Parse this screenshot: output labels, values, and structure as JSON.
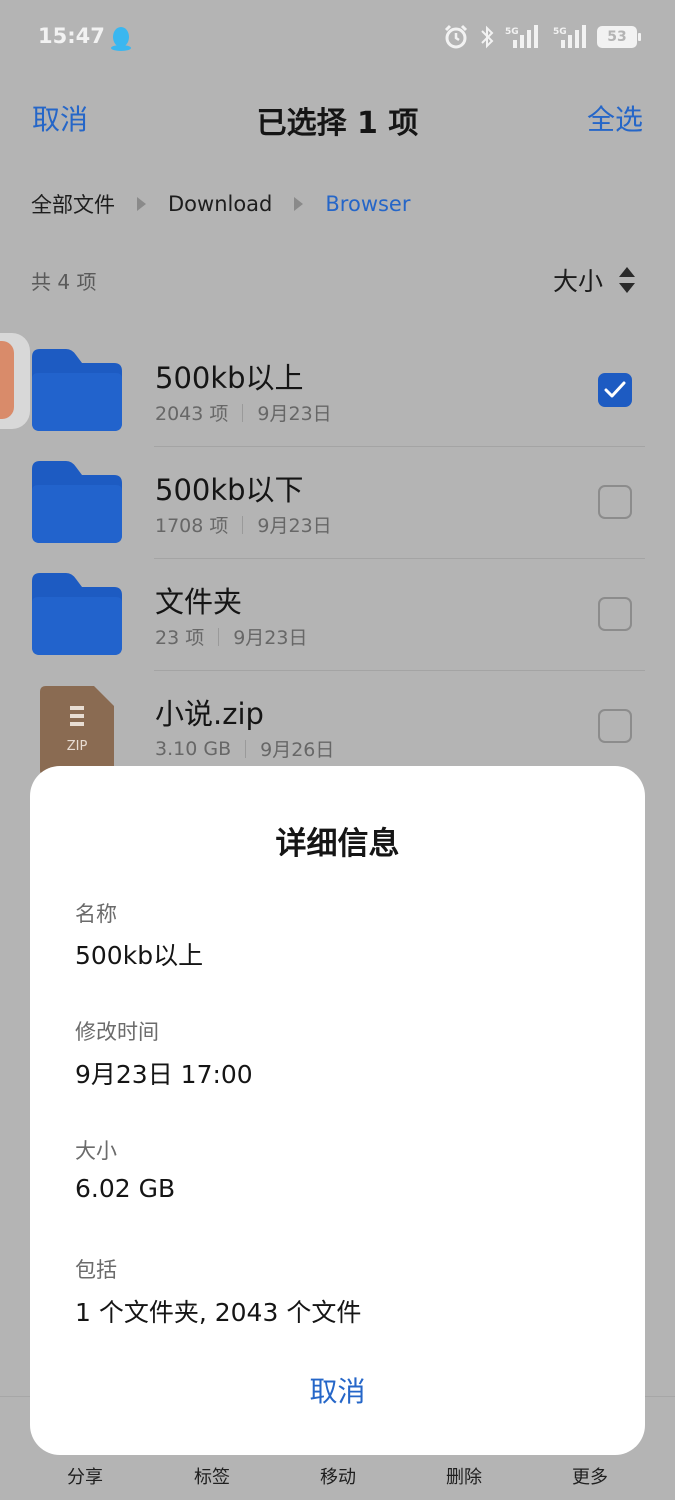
{
  "status_bar": {
    "time": "15:47",
    "qq_icon": "qq-penguin-icon",
    "alarm_icon": "alarm-icon",
    "bluetooth_icon": "bluetooth-icon",
    "signal1_label": "5G",
    "signal2_label": "5G",
    "battery": "53"
  },
  "action_bar": {
    "cancel": "取消",
    "title": "已选择 1 项",
    "select_all": "全选"
  },
  "breadcrumb": [
    "全部文件",
    "Download",
    "Browser"
  ],
  "list_header": {
    "count": "共 4 项",
    "sort_label": "大小"
  },
  "files": [
    {
      "name": "500kb以上",
      "info": "2043 项",
      "date": "9月23日",
      "type": "folder",
      "checked": true
    },
    {
      "name": "500kb以下",
      "info": "1708 项",
      "date": "9月23日",
      "type": "folder",
      "checked": false
    },
    {
      "name": "文件夹",
      "info": "23 项",
      "date": "9月23日",
      "type": "folder",
      "checked": false
    },
    {
      "name": "小说.zip",
      "info": "3.10 GB",
      "date": "9月26日",
      "type": "zip",
      "checked": false,
      "icon_text": "ZIP"
    }
  ],
  "dialog": {
    "title": "详细信息",
    "name_label": "名称",
    "name_value": "500kb以上",
    "modified_label": "修改时间",
    "modified_value": "9月23日 17:00",
    "size_label": "大小",
    "size_value": "6.02 GB",
    "includes_label": "包括",
    "includes_value": "1 个文件夹, 2043 个文件",
    "cancel": "取消"
  },
  "bottom_bar": [
    "分享",
    "标签",
    "移动",
    "删除",
    "更多"
  ],
  "colors": {
    "accent": "#2566c8",
    "folder": "#1d5bc2",
    "zip": "#8a6b52",
    "overlay_bg": "#b4b4b4"
  }
}
